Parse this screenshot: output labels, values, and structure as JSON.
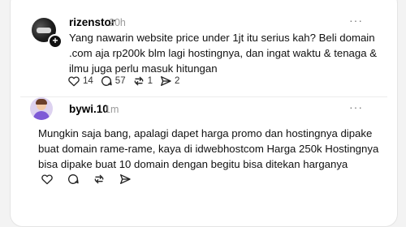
{
  "posts": [
    {
      "username": "rizenstor",
      "time": "20h",
      "more": "···",
      "text": "Yang nawarin website price under 1jt itu serius kah? Beli domain .com aja rp200k blm lagi hostingnya, dan ingat waktu & tenaga & ilmu juga perlu masuk hitungan",
      "likes": "14",
      "replies": "57",
      "reposts": "1",
      "shares": "2"
    },
    {
      "username": "bywi.10",
      "time": "1m",
      "more": "···",
      "text": "Mungkin saja bang, apalagi dapet harga promo dan hostingnya dipake buat domain rame-rame, kaya di idwebhostcom Harga 250k Hostingnya bisa dipake buat 10 domain dengan begitu bisa ditekan harganya"
    }
  ],
  "badge": "+",
  "icons": [
    "heart-icon",
    "comment-icon",
    "repost-icon",
    "share-icon",
    "more-icon"
  ],
  "colors": {
    "background": "#f3f3f3",
    "card": "#ffffff",
    "muted": "#9a9a9a"
  }
}
